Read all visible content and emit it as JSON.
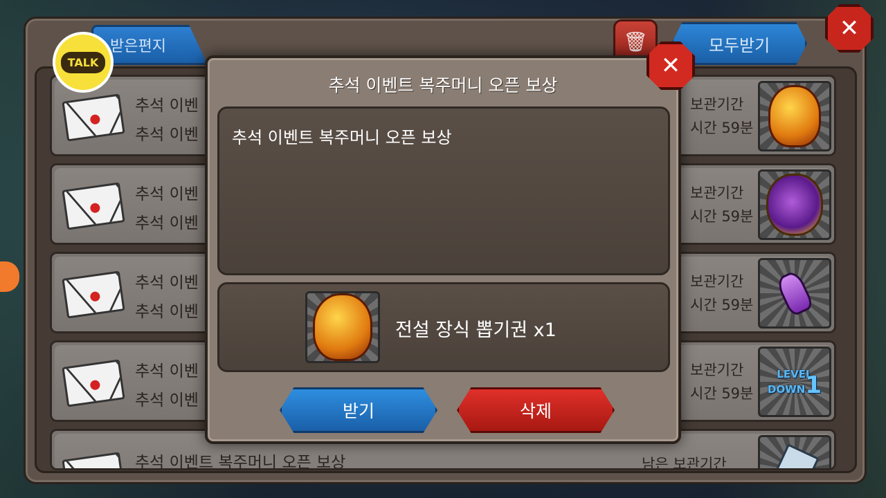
{
  "header": {
    "tab_label": "받은편지",
    "receive_all_label": "모두받기",
    "delete_icon": "trash-icon",
    "close_icon": "close-icon"
  },
  "talk_badge": {
    "label": "TALK"
  },
  "mail_rows": [
    {
      "title": "추석 이벤",
      "sub": "추석 이벤",
      "expiry1": "보관기간",
      "expiry2": "시간 59분",
      "icon": "legend-helmet-gold"
    },
    {
      "title": "추석 이벤",
      "sub": "추석 이벤",
      "expiry1": "보관기간",
      "expiry2": "시간 59분",
      "icon": "helmet-purple"
    },
    {
      "title": "추석 이벤",
      "sub": "추석 이벤",
      "expiry1": "보관기간",
      "expiry2": "시간 59분",
      "icon": "potion"
    },
    {
      "title": "추석 이벤",
      "sub": "추석 이벤",
      "expiry1": "보관기간",
      "expiry2": "시간 59분",
      "icon": "level-down"
    },
    {
      "title": "추석 이벤트 복주머니 오픈 보상",
      "sub": "",
      "expiry1": "남은 보관기간",
      "expiry2": "",
      "icon": "ticket"
    }
  ],
  "level_down_icon": {
    "line1": "LEVEL",
    "line2": "DOWN",
    "num": "1"
  },
  "modal": {
    "title": "추석 이벤트 복주머니 오픈 보상",
    "message": "추석 이벤트 복주머니 오픈 보상",
    "reward_text": "전설 장식 뽑기권 x1",
    "receive_label": "받기",
    "delete_label": "삭제"
  },
  "colors": {
    "primary_blue": "#1a5fa8",
    "danger_red": "#c8261d",
    "panel_brown": "#5e524a"
  }
}
